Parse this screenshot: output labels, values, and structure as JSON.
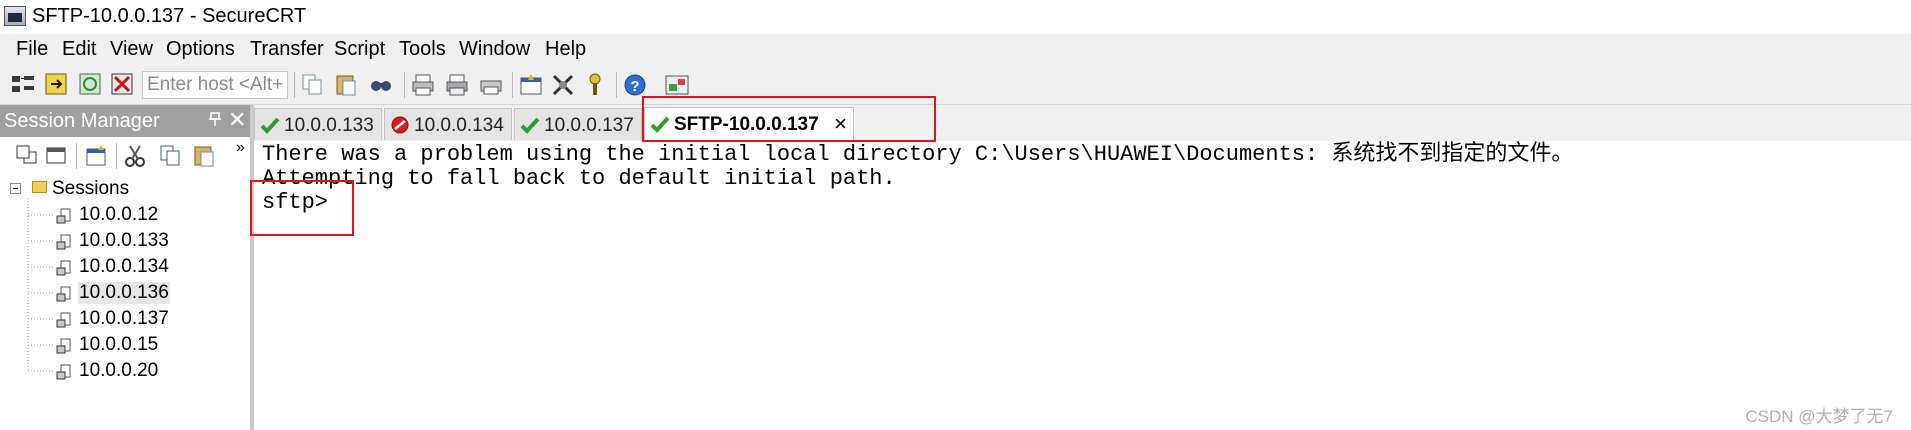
{
  "window": {
    "title": "SFTP-10.0.0.137 - SecureCRT"
  },
  "menu": {
    "items": [
      "File",
      "Edit",
      "View",
      "Options",
      "Transfer",
      "Script",
      "Tools",
      "Window",
      "Help"
    ]
  },
  "toolbar": {
    "host_placeholder": "Enter host <Alt+",
    "buttons": [
      "connect-icon",
      "quick-connect-icon",
      "reconnect-icon",
      "disconnect-icon",
      "copy-icon",
      "paste-icon",
      "find-icon",
      "print-icon",
      "print-selection-icon",
      "print-setup-icon",
      "session-options-icon",
      "global-options-icon",
      "keymap-icon",
      "help-icon",
      "sftp-icon"
    ]
  },
  "session_manager": {
    "title": "Session Manager",
    "root_label": "Sessions",
    "sessions": [
      {
        "label": "10.0.0.12",
        "selected": false
      },
      {
        "label": "10.0.0.133",
        "selected": false
      },
      {
        "label": "10.0.0.134",
        "selected": false
      },
      {
        "label": "10.0.0.136",
        "selected": true
      },
      {
        "label": "10.0.0.137",
        "selected": false
      },
      {
        "label": "10.0.0.15",
        "selected": false
      },
      {
        "label": "10.0.0.20",
        "selected": false
      }
    ]
  },
  "tabs": [
    {
      "label": "10.0.0.133",
      "status": "connected",
      "active": false
    },
    {
      "label": "10.0.0.134",
      "status": "disconnected",
      "active": false
    },
    {
      "label": "10.0.0.137",
      "status": "connected",
      "active": false
    },
    {
      "label": "SFTP-10.0.0.137",
      "status": "connected",
      "active": true,
      "close": "×"
    }
  ],
  "terminal": {
    "lines": [
      "There was a problem using the initial local directory C:\\Users\\HUAWEI\\Documents: 系统找不到指定的文件。",
      "Attempting to fall back to default initial path.",
      "sftp>"
    ]
  },
  "colors": {
    "highlight": "#e0141e",
    "connected": "#2e9e2e",
    "disconnected": "#d42020"
  },
  "watermark": "CSDN @大梦了无7"
}
